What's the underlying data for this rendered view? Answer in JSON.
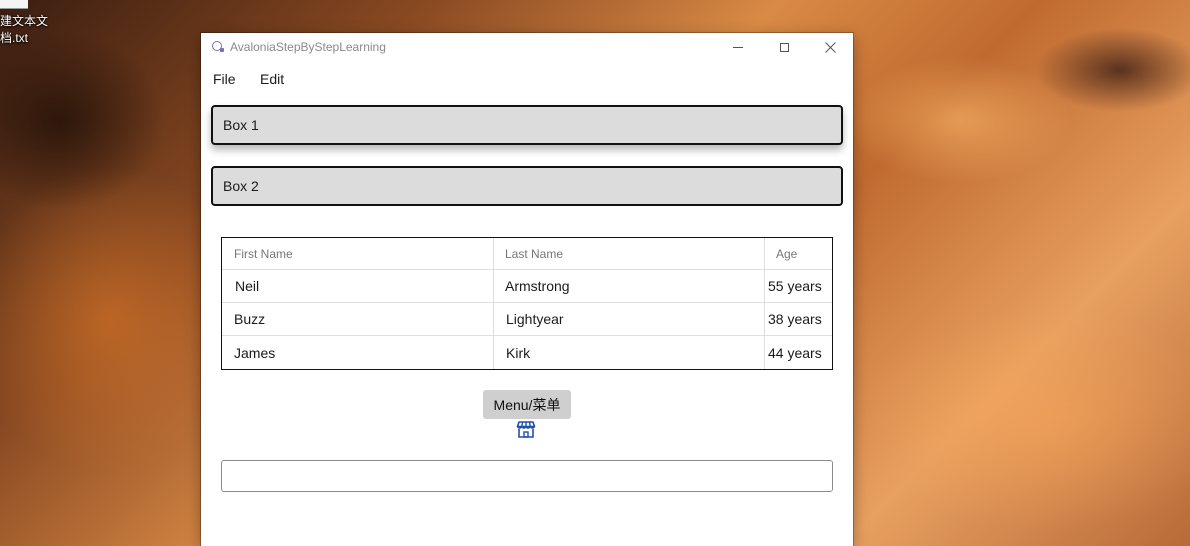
{
  "desktop": {
    "icon_caption_line1": "建文本文",
    "icon_caption_line2": "档.txt"
  },
  "window": {
    "title": "AvaloniaStepByStepLearning"
  },
  "menu": {
    "file": "File",
    "edit": "Edit"
  },
  "boxes": {
    "box1": "Box 1",
    "box2": "Box 2"
  },
  "grid": {
    "columns": [
      "First Name",
      "Last Name",
      "Age"
    ],
    "rows": [
      {
        "first": "Neil",
        "last": "Armstrong",
        "age": "55 years"
      },
      {
        "first": "Buzz",
        "last": "Lightyear",
        "age": "38 years"
      },
      {
        "first": "James",
        "last": "Kirk",
        "age": "44 years"
      }
    ]
  },
  "menu_button": {
    "label": "Menu/菜单"
  },
  "icons": {
    "store": "store-icon"
  },
  "input": {
    "value": ""
  }
}
